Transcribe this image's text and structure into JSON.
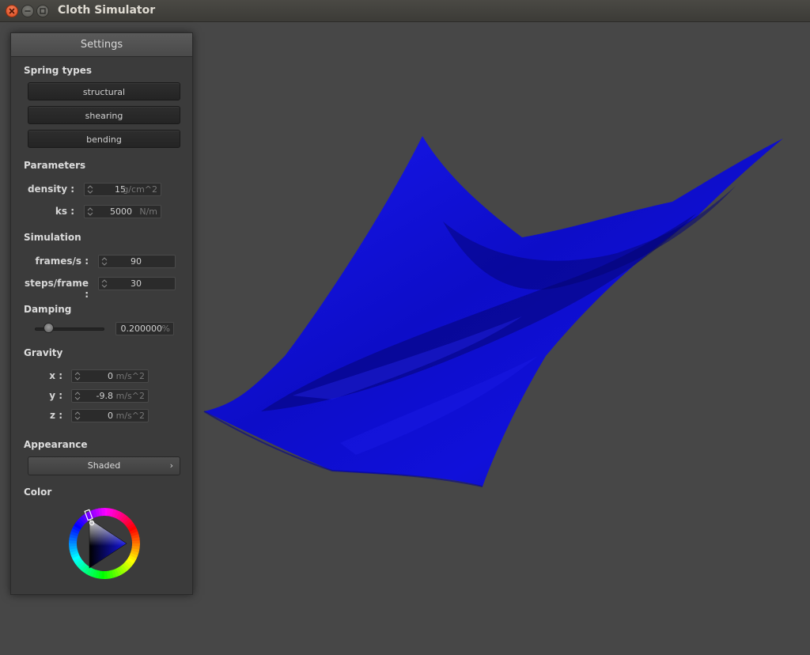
{
  "window": {
    "title": "Cloth Simulator"
  },
  "settings": {
    "header": "Settings",
    "spring_types": {
      "title": "Spring types",
      "buttons": [
        "structural",
        "shearing",
        "bending"
      ]
    },
    "parameters": {
      "title": "Parameters",
      "density": {
        "label": "density :",
        "value": "15",
        "unit": "g/cm^2"
      },
      "ks": {
        "label": "ks :",
        "value": "5000",
        "unit": "N/m"
      }
    },
    "simulation": {
      "title": "Simulation",
      "frames": {
        "label": "frames/s :",
        "value": "90"
      },
      "steps": {
        "label": "steps/frame :",
        "value": "30"
      }
    },
    "damping": {
      "title": "Damping",
      "value": "0.200000",
      "unit": "%",
      "slider_fraction": 0.2
    },
    "gravity": {
      "title": "Gravity",
      "x": {
        "label": "x :",
        "value": "0",
        "unit": "m/s^2"
      },
      "y": {
        "label": "y :",
        "value": "-9.8",
        "unit": "m/s^2"
      },
      "z": {
        "label": "z :",
        "value": "0",
        "unit": "m/s^2"
      }
    },
    "appearance": {
      "title": "Appearance",
      "selected": "Shaded"
    },
    "color": {
      "title": "Color",
      "selected_hex": "#1414e6"
    }
  },
  "cloth": {
    "color": "#1010e0"
  }
}
